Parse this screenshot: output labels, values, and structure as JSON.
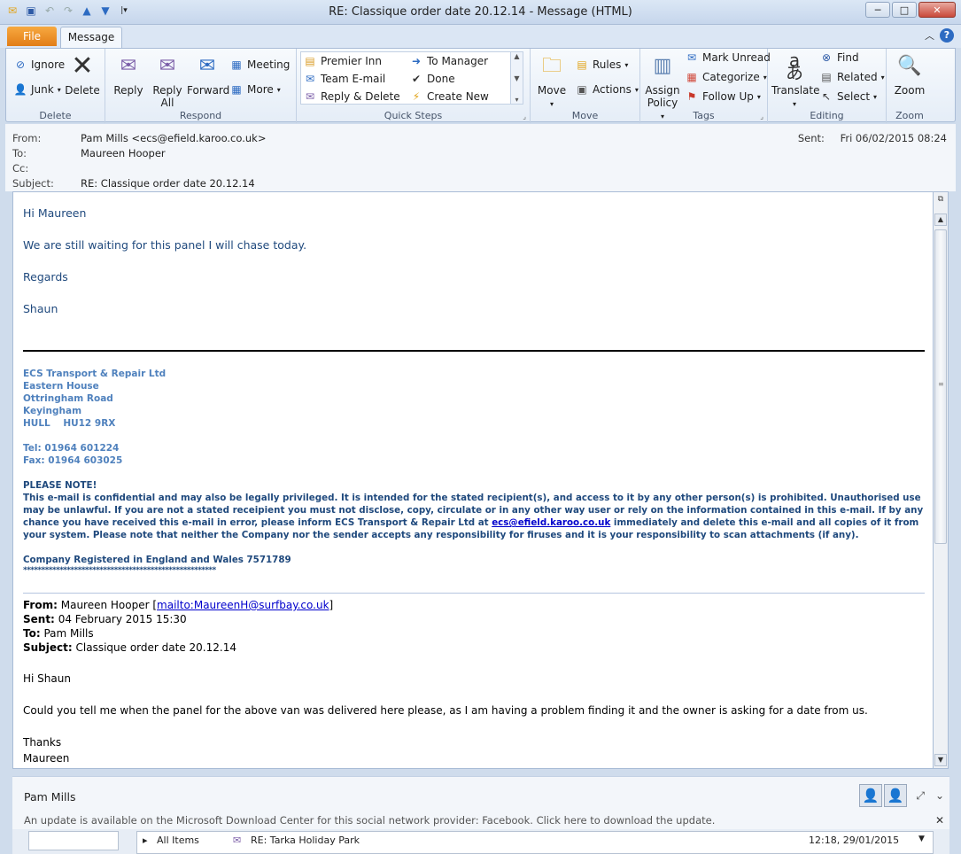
{
  "window": {
    "title": "RE: Classique order date 20.12.14  -  Message (HTML)",
    "minimize": "─",
    "maximize": "□",
    "close": "✕"
  },
  "tabs": {
    "file": "File",
    "message": "Message"
  },
  "ribbon": {
    "delete_group": {
      "label": "Delete",
      "ignore": "Ignore",
      "junk": "Junk",
      "delete": "Delete"
    },
    "respond_group": {
      "label": "Respond",
      "reply": "Reply",
      "reply_all_1": "Reply",
      "reply_all_2": "All",
      "forward": "Forward",
      "meeting": "Meeting",
      "more": "More"
    },
    "quick_steps_group": {
      "label": "Quick Steps",
      "items": [
        "Premier Inn",
        "Team E-mail",
        "Reply & Delete",
        "To Manager",
        "Done",
        "Create New"
      ]
    },
    "move_group": {
      "label": "Move",
      "move": "Move",
      "rules": "Rules",
      "actions": "Actions"
    },
    "tags_group": {
      "label": "Tags",
      "assign_1": "Assign",
      "assign_2": "Policy",
      "mark_unread": "Mark Unread",
      "categorize": "Categorize",
      "follow_up": "Follow Up"
    },
    "editing_group": {
      "label": "Editing",
      "translate": "Translate",
      "find": "Find",
      "related": "Related",
      "select": "Select"
    },
    "zoom_group": {
      "label": "Zoom",
      "zoom": "Zoom"
    }
  },
  "header": {
    "from_label": "From:",
    "from_value": "Pam Mills <ecs@efield.karoo.co.uk>",
    "to_label": "To:",
    "to_value": "Maureen Hooper",
    "cc_label": "Cc:",
    "subject_label": "Subject:",
    "subject_value": "RE: Classique order date 20.12.14",
    "sent_label": "Sent:",
    "sent_value": "Fri 06/02/2015 08:24"
  },
  "body": {
    "greeting": "Hi Maureen",
    "line1": "We are still waiting for this panel I will chase today.",
    "regards": "Regards",
    "name": "Shaun",
    "sig_company": "ECS Transport & Repair Ltd",
    "sig_addr1": "Eastern House",
    "sig_addr2": "Ottringham Road",
    "sig_addr3": "Keyingham",
    "sig_addr4": "HULL    HU12 9RX",
    "sig_tel": "Tel: 01964 601224",
    "sig_fax": "Fax: 01964 603025",
    "notice_title": "PLEASE NOTE!",
    "notice_text1": "This e-mail is confidential and may also be legally privileged.  It is intended for the stated recipient(s), and access to it by any other person(s) is prohibited.  Unauthorised use may be unlawful.  If you are not a stated receipient you must not disclose, copy, circulate or in any other way user or rely on the information contained in this e-mail.  If by any chance you have received this e-mail in error, please inform ECS Transport & Repair Ltd at ",
    "notice_link": "ecs@efield.karoo.co.uk",
    "notice_text2": " immediately and delete this e-mail and all copies of it from your system.  Please note that neither the Company nor the sender accepts any responsibility for firuses and it is your responsibility to scan attachments (if any).",
    "registered": "Company Registered in England and Wales 7571789",
    "stars": "*****************************************************",
    "orig_from_label": "From:",
    "orig_from_value": "Maureen Hooper [",
    "orig_from_link": "mailto:MaureenH@surfbay.co.uk",
    "orig_from_end": "]",
    "orig_sent_label": "Sent:",
    "orig_sent_value": "04 February 2015 15:30",
    "orig_to_label": "To:",
    "orig_to_value": "Pam Mills",
    "orig_subject_label": "Subject:",
    "orig_subject_value": "Classique order date 20.12.14",
    "orig_greeting": "Hi Shaun",
    "orig_line1": "Could you tell me when the panel for the above van was delivered here please, as I am having a problem finding it and the owner is asking for a date from us.",
    "orig_thanks": "Thanks",
    "orig_name": "Maureen"
  },
  "people_pane": {
    "name": "Pam Mills",
    "update_notice": "An update is available on the Microsoft Download Center for this social network provider: Facebook. Click here to download the update."
  },
  "bottom": {
    "all_items": "All Items",
    "item_subject": "RE: Tarka Holiday Park",
    "item_time": "12:18, 29/01/2015"
  }
}
